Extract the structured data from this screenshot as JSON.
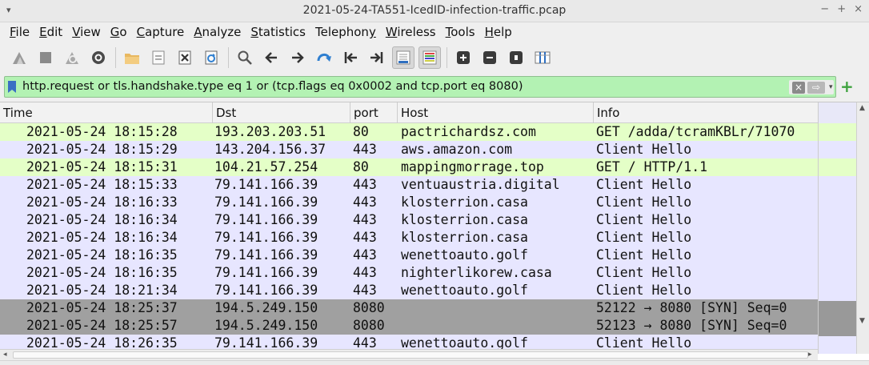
{
  "window": {
    "title": "2021-05-24-TA551-IcedID-infection-traffic.pcap",
    "controls": [
      "−",
      "+",
      "×"
    ],
    "wm_menu": "▾"
  },
  "menu": [
    {
      "u": "F",
      "rest": "ile"
    },
    {
      "u": "E",
      "rest": "dit"
    },
    {
      "u": "V",
      "rest": "iew"
    },
    {
      "u": "G",
      "rest": "o"
    },
    {
      "u": "C",
      "rest": "apture"
    },
    {
      "u": "A",
      "rest": "nalyze"
    },
    {
      "u": "S",
      "rest": "tatistics"
    },
    {
      "pre": "Telephon",
      "u": "y",
      "rest": ""
    },
    {
      "u": "W",
      "rest": "ireless"
    },
    {
      "u": "T",
      "rest": "ools"
    },
    {
      "u": "H",
      "rest": "elp"
    }
  ],
  "toolbar_icons": [
    "shark-fin-start-icon",
    "stop-icon",
    "restart-icon",
    "capture-options-icon",
    "open-folder-icon",
    "save-file-icon",
    "close-file-icon",
    "reload-icon",
    "find-icon",
    "back-arrow-icon",
    "forward-arrow-icon",
    "go-to-packet-icon",
    "first-packet-icon",
    "last-packet-icon",
    "autoscroll-icon",
    "colorize-icon",
    "zoom-in-icon",
    "zoom-out-icon",
    "normal-size-icon",
    "resize-columns-icon"
  ],
  "filter": {
    "text": "http.request or tls.handshake.type eq 1 or (tcp.flags eq 0x0002 and tcp.port eq 8080)",
    "clear_glyph": "×",
    "apply_glyph": "⇨",
    "dropdown_glyph": "▾",
    "add_glyph": "+"
  },
  "columns": {
    "time": "Time",
    "dst": "Dst",
    "port": "port",
    "host": "Host",
    "info": "Info"
  },
  "colors": {
    "http_row": "#e4ffc7",
    "tcp_row": "#e7e6ff",
    "syn_row": "#a0a0a0",
    "filter_valid": "#b3f2b3"
  },
  "packets": [
    {
      "time": "2021-05-24 18:15:28",
      "dst": "193.203.203.51",
      "port": "80",
      "host": "pactrichardsz.com",
      "info": "GET /adda/tcramKBLr/71070",
      "kind": "http"
    },
    {
      "time": "2021-05-24 18:15:29",
      "dst": "143.204.156.37",
      "port": "443",
      "host": "aws.amazon.com",
      "info": "Client Hello",
      "kind": "tcp"
    },
    {
      "time": "2021-05-24 18:15:31",
      "dst": "104.21.57.254",
      "port": "80",
      "host": "mappingmorrage.top",
      "info": "GET / HTTP/1.1",
      "kind": "http"
    },
    {
      "time": "2021-05-24 18:15:33",
      "dst": "79.141.166.39",
      "port": "443",
      "host": "ventuaustria.digital",
      "info": "Client Hello",
      "kind": "tcp"
    },
    {
      "time": "2021-05-24 18:16:33",
      "dst": "79.141.166.39",
      "port": "443",
      "host": "klosterrion.casa",
      "info": "Client Hello",
      "kind": "tcp"
    },
    {
      "time": "2021-05-24 18:16:34",
      "dst": "79.141.166.39",
      "port": "443",
      "host": "klosterrion.casa",
      "info": "Client Hello",
      "kind": "tcp"
    },
    {
      "time": "2021-05-24 18:16:34",
      "dst": "79.141.166.39",
      "port": "443",
      "host": "klosterrion.casa",
      "info": "Client Hello",
      "kind": "tcp"
    },
    {
      "time": "2021-05-24 18:16:35",
      "dst": "79.141.166.39",
      "port": "443",
      "host": "wenettoauto.golf",
      "info": "Client Hello",
      "kind": "tcp"
    },
    {
      "time": "2021-05-24 18:16:35",
      "dst": "79.141.166.39",
      "port": "443",
      "host": "nighterlikorew.casa",
      "info": "Client Hello",
      "kind": "tcp"
    },
    {
      "time": "2021-05-24 18:21:34",
      "dst": "79.141.166.39",
      "port": "443",
      "host": "wenettoauto.golf",
      "info": "Client Hello",
      "kind": "tcp"
    },
    {
      "time": "2021-05-24 18:25:37",
      "dst": "194.5.249.150",
      "port": "8080",
      "host": "",
      "info": "52122 → 8080 [SYN] Seq=0",
      "kind": "syn"
    },
    {
      "time": "2021-05-24 18:25:57",
      "dst": "194.5.249.150",
      "port": "8080",
      "host": "",
      "info": "52123 → 8080 [SYN] Seq=0",
      "kind": "syn"
    },
    {
      "time": "2021-05-24 18:26:35",
      "dst": "79.141.166.39",
      "port": "443",
      "host": "wenettoauto.golf",
      "info": "Client Hello",
      "kind": "tcp"
    }
  ]
}
